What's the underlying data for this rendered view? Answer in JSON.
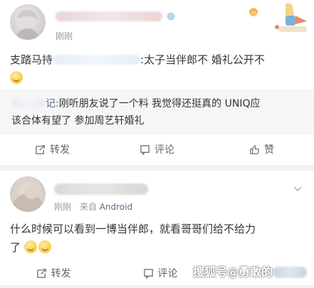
{
  "post1": {
    "time": "刚刚",
    "text_prefix": "支踏马持",
    "text_suffix": ":太子当伴郎不 婚礼公开不",
    "repost": {
      "name_suffix": "记:",
      "line1": "刚听朋友说了一个料 我觉得还挺真的 UNIQ应",
      "line2": "该合体有望了 参加周艺轩婚礼"
    },
    "actions": {
      "repost_label": "转发",
      "comment_label": "评论",
      "like_label": "赞"
    }
  },
  "post2": {
    "time": "刚刚",
    "source_prefix": "来自",
    "source_name": "Android",
    "line1": "什么时候可以看到一博当伴郎，就看哥哥们给不给力",
    "line2": "了",
    "actions": {
      "repost_label": "转发",
      "comment_label": "评论"
    }
  },
  "watermark": "搜狐号@勇敢的",
  "colors": {
    "link": "#5d6c8a",
    "text": "#333333",
    "muted": "#999999",
    "bg": "#f2f2f2"
  }
}
